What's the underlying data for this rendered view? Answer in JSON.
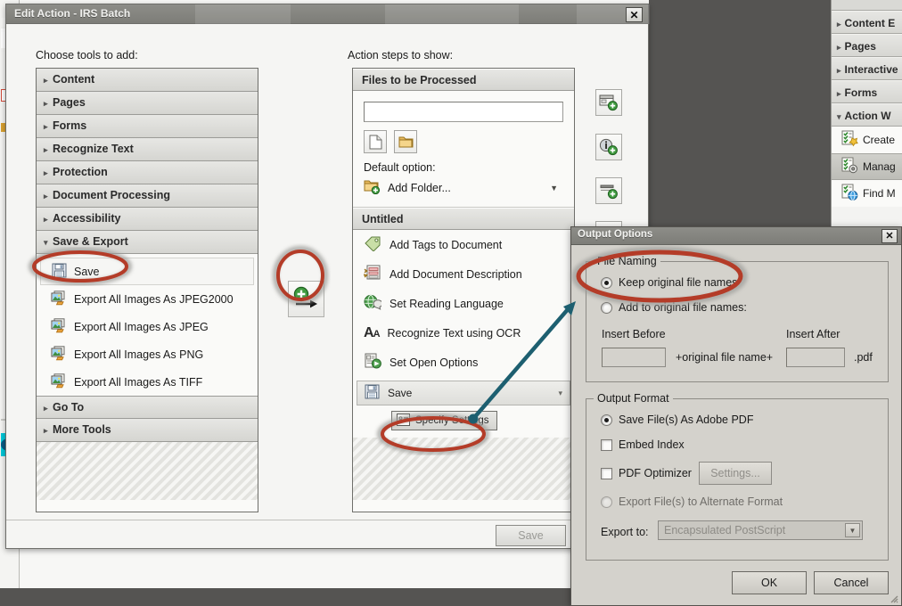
{
  "edit_action_dialog": {
    "title": "Edit Action - IRS Batch",
    "close_label": "✕",
    "left_label": "Choose tools to add:",
    "right_label": "Action steps to show:",
    "save_button": "Save",
    "tool_categories": [
      {
        "label": "Content",
        "expanded": false,
        "arrow": "▸"
      },
      {
        "label": "Pages",
        "expanded": false,
        "arrow": "▸"
      },
      {
        "label": "Forms",
        "expanded": false,
        "arrow": "▸"
      },
      {
        "label": "Recognize Text",
        "expanded": false,
        "arrow": "▸"
      },
      {
        "label": "Protection",
        "expanded": false,
        "arrow": "▸"
      },
      {
        "label": "Document Processing",
        "expanded": false,
        "arrow": "▸"
      },
      {
        "label": "Accessibility",
        "expanded": false,
        "arrow": "▸"
      },
      {
        "label": "Save & Export",
        "expanded": true,
        "arrow": "▾"
      }
    ],
    "save_export_items": [
      {
        "label": "Save",
        "icon": "floppy-disk-icon",
        "selected": true
      },
      {
        "label": "Export All Images As JPEG2000",
        "icon": "export-images-icon",
        "selected": false
      },
      {
        "label": "Export All Images As JPEG",
        "icon": "export-images-icon",
        "selected": false
      },
      {
        "label": "Export All Images As PNG",
        "icon": "export-images-icon",
        "selected": false
      },
      {
        "label": "Export All Images As TIFF",
        "icon": "export-images-icon",
        "selected": false
      }
    ],
    "tool_categories_bottom": [
      {
        "label": "Go To",
        "arrow": "▸"
      },
      {
        "label": "More Tools",
        "arrow": "▸"
      }
    ],
    "add_step_button_icon": "add-step-arrow-icon",
    "steps_panel": {
      "files_header": "Files to be Processed",
      "files_input_value": "",
      "add_file_icon": "document-icon",
      "add_folder_icon": "folder-icon",
      "default_option_label": "Default option:",
      "default_option_value": "Add Folder...",
      "default_option_icon": "add-folder-icon",
      "section_header": "Untitled",
      "steps": [
        {
          "label": "Add Tags to Document",
          "icon": "tag-icon"
        },
        {
          "label": "Add Document Description",
          "icon": "document-description-icon"
        },
        {
          "label": "Set Reading Language",
          "icon": "globe-speech-icon"
        },
        {
          "label": "Recognize Text using OCR",
          "icon": "ocr-aa-icon"
        },
        {
          "label": "Set Open Options",
          "icon": "open-options-icon"
        }
      ],
      "save_step": {
        "label": "Save",
        "icon": "floppy-disk-icon",
        "caret": "▾"
      },
      "specify_settings": {
        "label": "Specify Settings",
        "icon": "settings-list-icon"
      }
    },
    "side_tools": [
      {
        "name": "add-panel-button",
        "icon": "panel-plus-icon"
      },
      {
        "name": "add-instruction-button",
        "icon": "info-plus-icon"
      },
      {
        "name": "add-divider-button",
        "icon": "divider-plus-icon"
      },
      {
        "name": "move-up-button",
        "icon": "triangle-up-icon",
        "glyph": "▲"
      }
    ]
  },
  "output_options_dialog": {
    "title": "Output Options",
    "close_label": "✕",
    "file_naming": {
      "group_title": "File Naming",
      "keep_original": {
        "label": "Keep original file names",
        "checked": true
      },
      "add_to_original": {
        "label": "Add to original file names:",
        "checked": false
      },
      "insert_before_label": "Insert Before",
      "insert_after_label": "Insert After",
      "insert_before_value": "",
      "insert_after_value": "",
      "middle_text": "+original file name+",
      "extension_text": ".pdf"
    },
    "output_format": {
      "group_title": "Output Format",
      "save_as_pdf": {
        "label": "Save File(s) As Adobe PDF",
        "checked": true
      },
      "embed_index": {
        "label": "Embed Index",
        "checked": false
      },
      "pdf_optimizer": {
        "label": "PDF Optimizer",
        "checked": false
      },
      "settings_button": "Settings...",
      "export_alternate": {
        "label": "Export File(s) to Alternate Format",
        "checked": false
      },
      "export_to_label": "Export to:",
      "export_to_value": "Encapsulated PostScript",
      "export_to_arrow": "▾"
    },
    "ok_button": "OK",
    "cancel_button": "Cancel"
  },
  "acrobat_right_panel": {
    "sections": [
      {
        "label": "Content E",
        "arrow": "▸",
        "expanded": false
      },
      {
        "label": "Pages",
        "arrow": "▸",
        "expanded": false
      },
      {
        "label": "Interactive",
        "arrow": "▸",
        "expanded": false
      },
      {
        "label": "Forms",
        "arrow": "▸",
        "expanded": false
      },
      {
        "label": "Action W",
        "arrow": "▾",
        "expanded": true
      }
    ],
    "action_wizard_items": [
      {
        "label": "Create",
        "icon": "create-action-icon",
        "selected": false
      },
      {
        "label": "Manag",
        "icon": "manage-action-icon",
        "selected": true
      },
      {
        "label": "Find M",
        "icon": "find-more-icon",
        "selected": false
      }
    ]
  },
  "annotations": {
    "highlight_color": "#b43c28",
    "arrow_color": "#1d5f70",
    "ellipses": [
      {
        "name": "save-tool-highlight"
      },
      {
        "name": "add-step-button-highlight"
      },
      {
        "name": "specify-settings-highlight"
      },
      {
        "name": "keep-original-file-names-highlight"
      }
    ]
  }
}
